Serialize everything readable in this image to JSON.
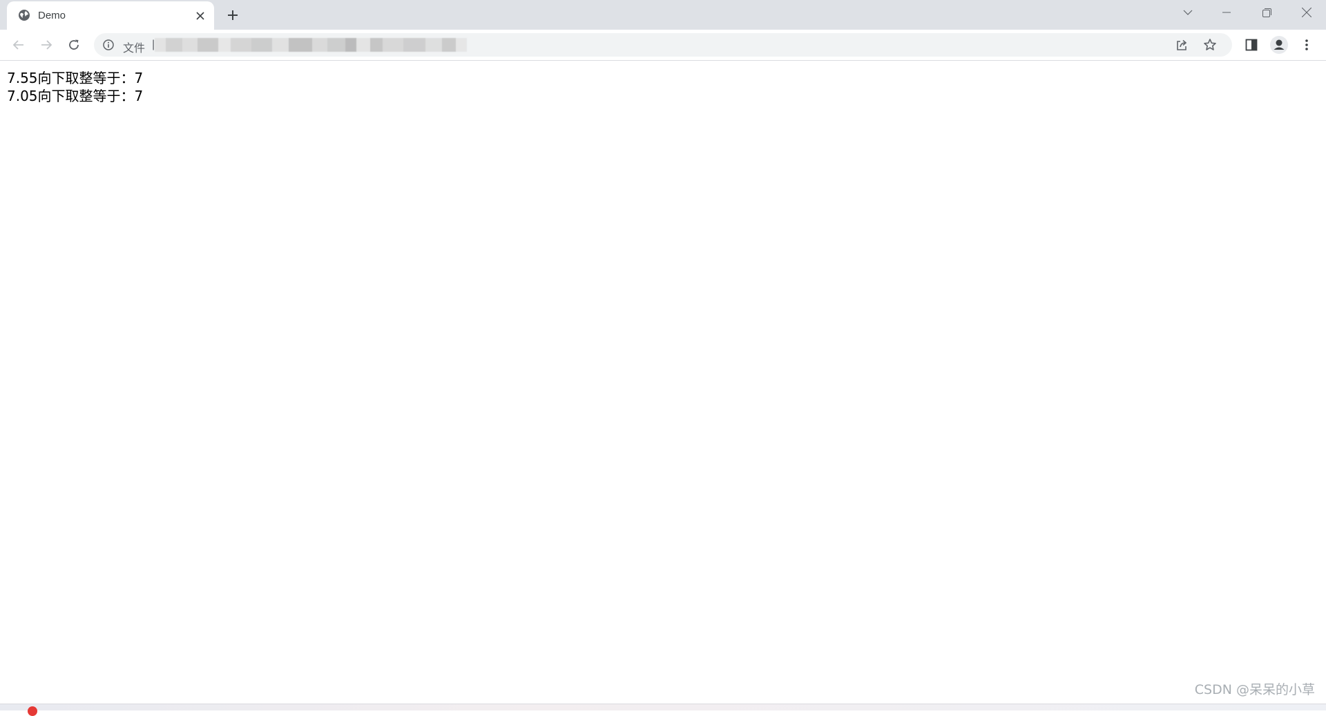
{
  "browser": {
    "tab": {
      "title": "Demo",
      "favicon": "globe-icon",
      "close_icon": "close-icon"
    },
    "new_tab_icon": "plus-icon",
    "window_controls": [
      "tab-search-icon",
      "minimize-icon",
      "restore-icon",
      "close-window-icon"
    ],
    "toolbar": {
      "back_icon": "back-arrow-icon",
      "forward_icon": "forward-arrow-icon",
      "reload_icon": "reload-icon",
      "address": {
        "info_icon": "info-icon",
        "scheme_label": "文件",
        "separator": "|",
        "url_blurred": true
      },
      "right_icons": [
        "share-icon",
        "star-icon",
        "side-panel-icon",
        "profile-icon",
        "more-menu-icon"
      ]
    }
  },
  "page": {
    "lines": [
      "7.55向下取整等于：7",
      "7.05向下取整等于：7"
    ]
  },
  "watermark": "CSDN @呆呆的小草",
  "colors": {
    "tabstrip_bg": "#dee1e6",
    "omnibox_bg": "#f1f3f4",
    "icon_gray": "#5f6368",
    "text": "#000000"
  }
}
